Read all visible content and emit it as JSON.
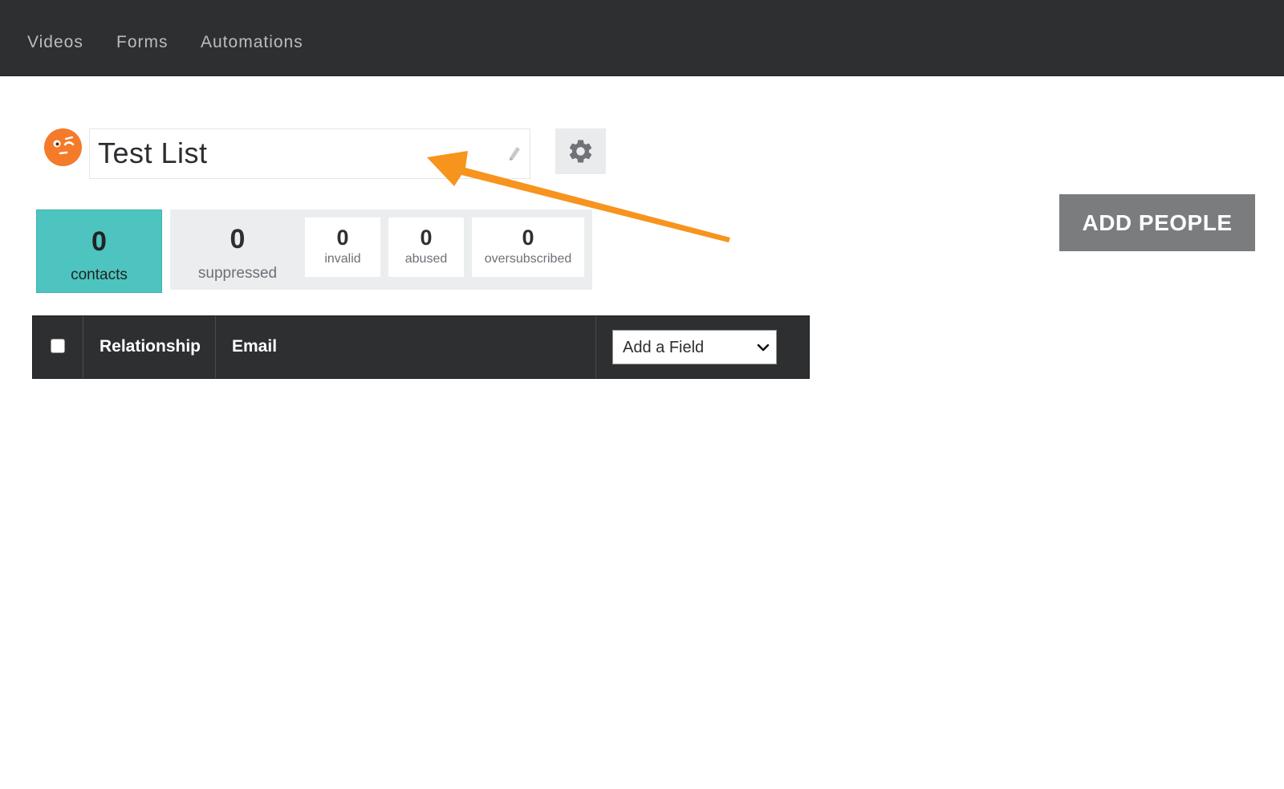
{
  "nav": {
    "items": [
      {
        "label": "Videos"
      },
      {
        "label": "Forms"
      },
      {
        "label": "Automations"
      }
    ]
  },
  "list": {
    "title": "Test List"
  },
  "stats": {
    "contacts": {
      "value": "0",
      "label": "contacts"
    },
    "suppressed": {
      "value": "0",
      "label": "suppressed"
    },
    "invalid": {
      "value": "0",
      "label": "invalid"
    },
    "abused": {
      "value": "0",
      "label": "abused"
    },
    "oversubscribed": {
      "value": "0",
      "label": "oversubscribed"
    }
  },
  "actions": {
    "add_people_label": "ADD PEOPLE"
  },
  "table": {
    "columns": [
      {
        "label": "Relationship"
      },
      {
        "label": "Email"
      }
    ],
    "add_field": {
      "selected": "Add a Field"
    }
  },
  "icons": {
    "avatar": "winking-face-icon",
    "edit": "pencil-icon",
    "settings": "gear-icon",
    "select": "chevron-down-icon",
    "annotation": "arrow-icon"
  },
  "colors": {
    "nav_bg": "#2e2f31",
    "accent_teal": "#4dc4bf",
    "avatar_orange": "#f47b2a",
    "annotation_arrow": "#f7941d",
    "button_gray": "#7a7c7e"
  }
}
